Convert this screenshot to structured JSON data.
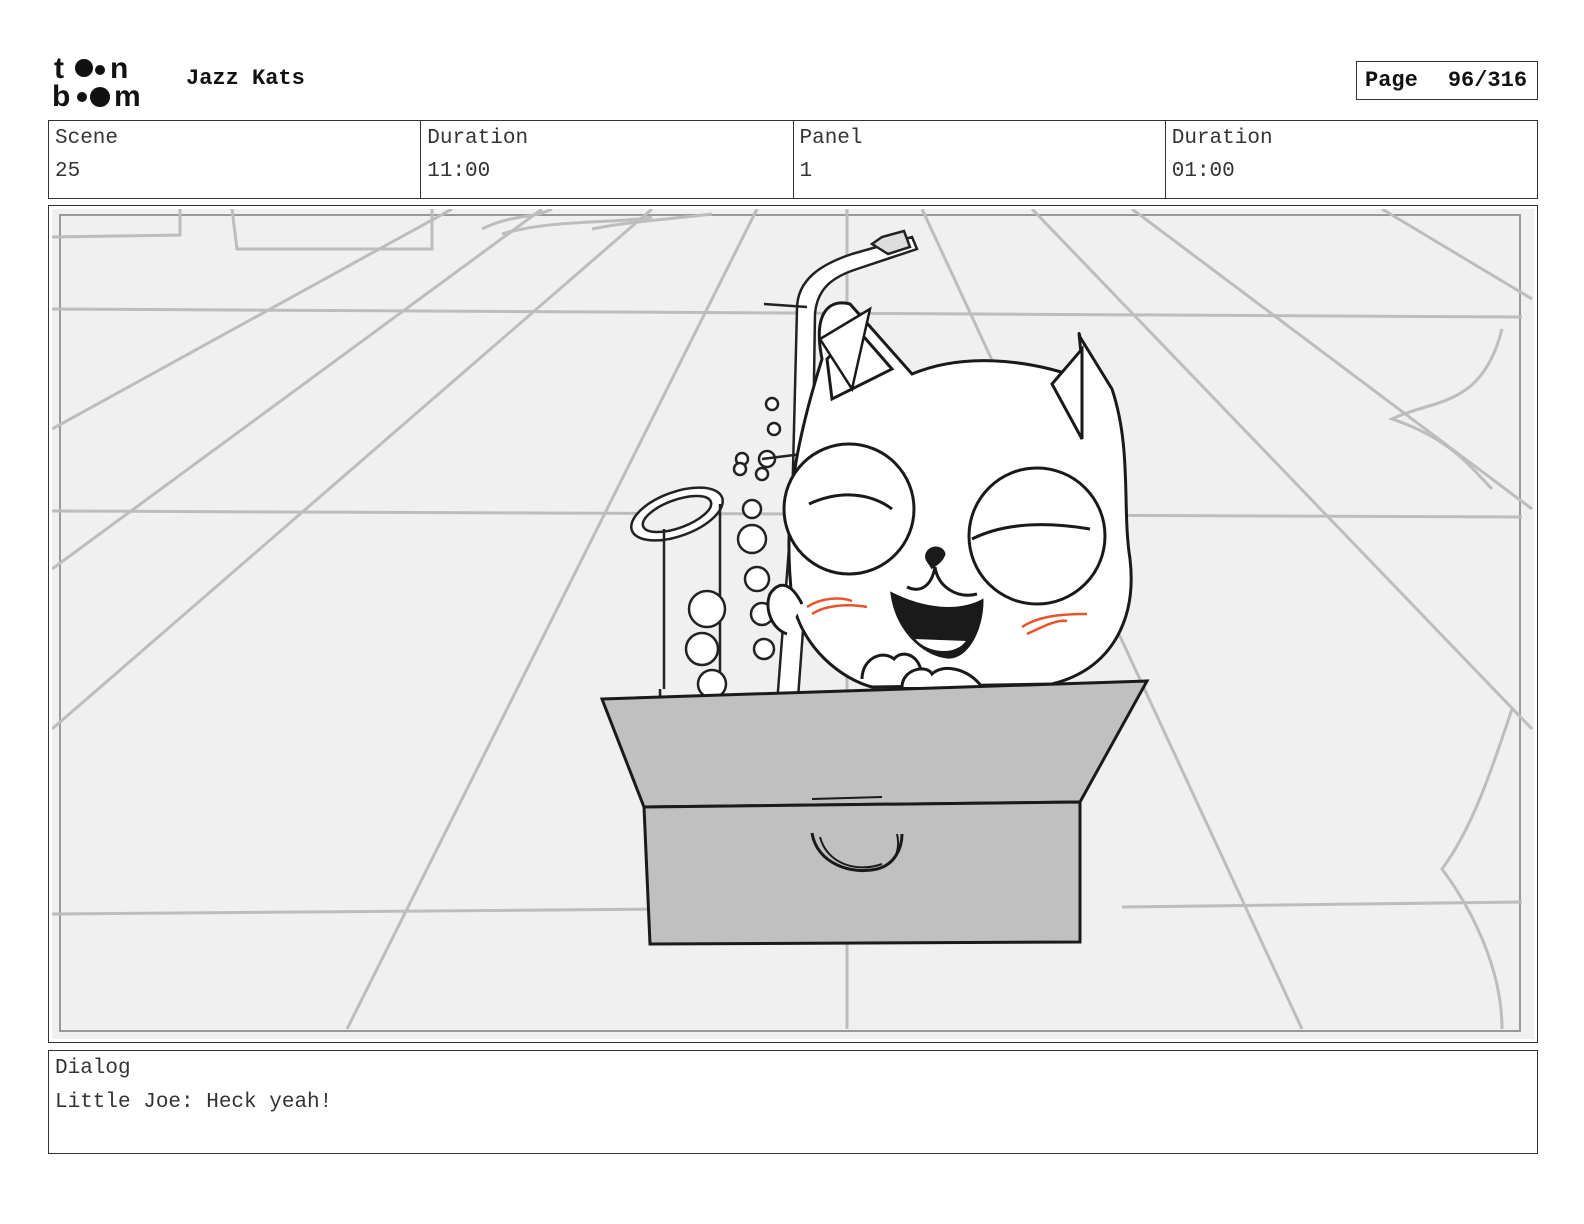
{
  "header": {
    "logo_text": "toon boom",
    "project_title": "Jazz Kats",
    "page_label": "Page",
    "page_value": "96/316"
  },
  "info": {
    "scene_label": "Scene",
    "scene_value": "25",
    "scene_duration_label": "Duration",
    "scene_duration_value": "11:00",
    "panel_label": "Panel",
    "panel_value": "1",
    "panel_duration_label": "Duration",
    "panel_duration_value": "01:00"
  },
  "dialog": {
    "label": "Dialog",
    "text": "Little Joe: Heck yeah!"
  },
  "colors": {
    "box_fill": "#c0c0c0",
    "background_sketch": "#bdbdbd",
    "blush": "#e8542a"
  }
}
